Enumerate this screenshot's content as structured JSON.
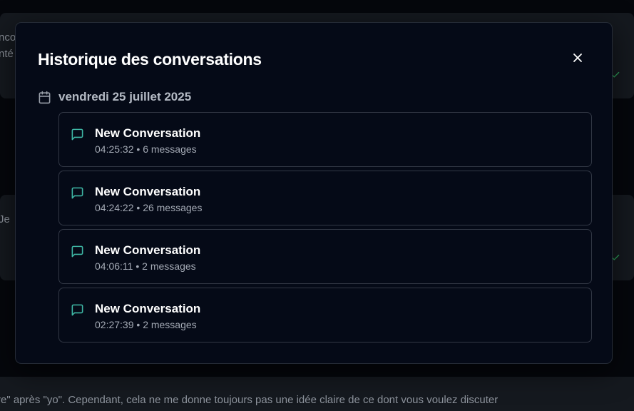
{
  "background": {
    "line1": "nco",
    "line2": "nté",
    "line3": "Je",
    "bottom_text": "re\" après \"yo\". Cependant, cela ne me donne toujours pas une idée claire de ce dont vous voulez discuter"
  },
  "modal": {
    "title": "Historique des conversations",
    "close_icon": "close-icon",
    "date_icon": "calendar-icon",
    "date_label": "vendredi 25 juillet 2025",
    "conversations": [
      {
        "title": "New Conversation",
        "time": "04:25:32",
        "separator": "•",
        "count": "6 messages"
      },
      {
        "title": "New Conversation",
        "time": "04:24:22",
        "separator": "•",
        "count": "26 messages"
      },
      {
        "title": "New Conversation",
        "time": "04:06:11",
        "separator": "•",
        "count": "2 messages"
      },
      {
        "title": "New Conversation",
        "time": "02:27:39",
        "separator": "•",
        "count": "2 messages"
      }
    ]
  },
  "colors": {
    "accent": "#3fb8a6",
    "status_green": "#2ea35b"
  }
}
